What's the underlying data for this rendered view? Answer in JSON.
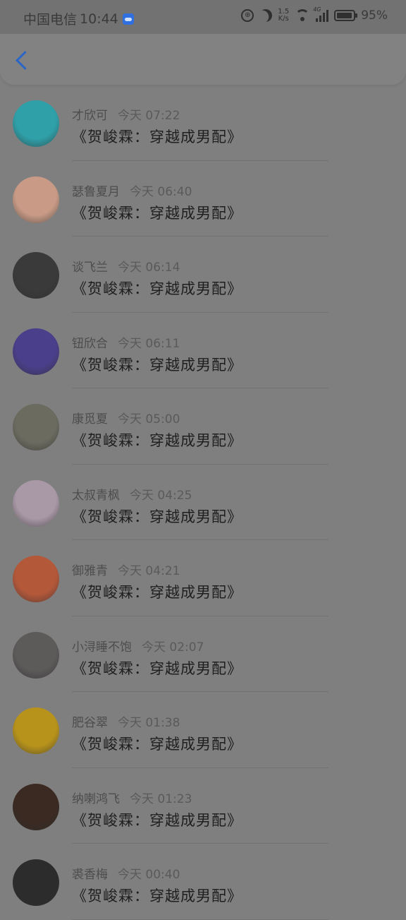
{
  "status_bar": {
    "carrier": "中国电信",
    "time": "10:44",
    "speed_top": "1.5",
    "speed_bottom": "K/s",
    "network": "4G",
    "battery": "95%"
  },
  "header": {
    "back_icon": "chevron-left-icon",
    "accent": "#2b66c6"
  },
  "items": [
    {
      "name": "才欣可",
      "time": "今天 07:22",
      "message": "《贺峻霖：穿越成男配》",
      "avatar_color": "#2f9fa8"
    },
    {
      "name": "瑟鲁夏月",
      "time": "今天 06:40",
      "message": "《贺峻霖：穿越成男配》",
      "avatar_color": "#c99b86"
    },
    {
      "name": "谈飞兰",
      "time": "今天 06:14",
      "message": "《贺峻霖：穿越成男配》",
      "avatar_color": "#3a3a3a"
    },
    {
      "name": "钮欣合",
      "time": "今天 06:11",
      "message": "《贺峻霖：穿越成男配》",
      "avatar_color": "#4a3f8a"
    },
    {
      "name": "康觅夏",
      "time": "今天 05:00",
      "message": "《贺峻霖：穿越成男配》",
      "avatar_color": "#6b6b60"
    },
    {
      "name": "太叔青枫",
      "time": "今天 04:25",
      "message": "《贺峻霖：穿越成男配》",
      "avatar_color": "#a998a6"
    },
    {
      "name": "御雅青",
      "time": "今天 04:21",
      "message": "《贺峻霖：穿越成男配》",
      "avatar_color": "#b4583a"
    },
    {
      "name": "小浔睡不饱",
      "time": "今天 02:07",
      "message": "《贺峻霖：穿越成男配》",
      "avatar_color": "#5d5a5a"
    },
    {
      "name": "肥谷翠",
      "time": "今天 01:38",
      "message": "《贺峻霖：穿越成男配》",
      "avatar_color": "#b8931b"
    },
    {
      "name": "纳喇鸿飞",
      "time": "今天 01:23",
      "message": "《贺峻霖：穿越成男配》",
      "avatar_color": "#3a2a22"
    },
    {
      "name": "裘香梅",
      "time": "今天 00:40",
      "message": "《贺峻霖：穿越成男配》",
      "avatar_color": "#2c2c2c"
    }
  ]
}
